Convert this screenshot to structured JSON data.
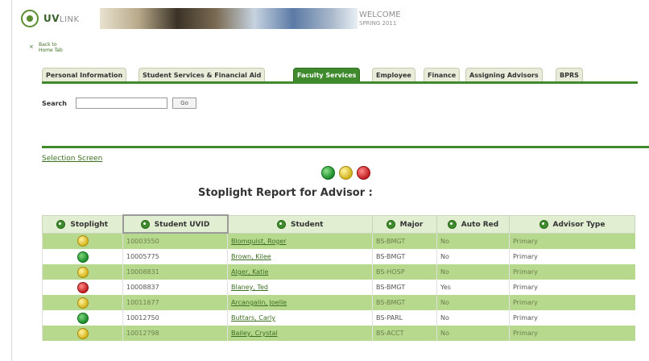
{
  "header": {
    "logo_text": "UV",
    "logo_sub": "LINK",
    "welcome": "WELCOME",
    "welcome_sub": "SPRING 2011"
  },
  "nav": {
    "back_line1": "Back to",
    "back_line2": "Home Tab",
    "back_icon": "×"
  },
  "tabs": [
    {
      "label": "Personal Information",
      "active": false
    },
    {
      "label": "Student Services & Financial Aid",
      "active": false
    },
    {
      "label": "Faculty Services",
      "active": true
    },
    {
      "label": "Employee",
      "active": false
    },
    {
      "label": "Finance",
      "active": false
    },
    {
      "label": "Assigning Advisors",
      "active": false
    },
    {
      "label": "BPRS",
      "active": false
    }
  ],
  "search": {
    "label": "Search",
    "value": "",
    "button": "Go"
  },
  "selection_link": "Selection Screen",
  "report_title": "Stoplight Report for Advisor :",
  "table": {
    "columns": [
      "Stoplight",
      "Student UVID",
      "Student",
      "Major",
      "Auto Red",
      "Advisor Type"
    ],
    "rows": [
      {
        "stoplight": "yellow",
        "uvid": "10003550",
        "student": "Blomquist, Roger",
        "major": "BS-BMGT",
        "auto_red": "No",
        "advisor_type": "Primary"
      },
      {
        "stoplight": "green",
        "uvid": "10005775",
        "student": "Brown, Kilee",
        "major": "BS-BMGT",
        "auto_red": "No",
        "advisor_type": "Primary"
      },
      {
        "stoplight": "yellow",
        "uvid": "10008831",
        "student": "Alger, Katie",
        "major": "BS-HOSP",
        "auto_red": "No",
        "advisor_type": "Primary"
      },
      {
        "stoplight": "red",
        "uvid": "10008837",
        "student": "Blaney, Ted",
        "major": "BS-BMGT",
        "auto_red": "Yes",
        "advisor_type": "Primary"
      },
      {
        "stoplight": "yellow",
        "uvid": "10011677",
        "student": "Arcangalin, Joelle",
        "major": "BS-BMGT",
        "auto_red": "No",
        "advisor_type": "Primary"
      },
      {
        "stoplight": "green",
        "uvid": "10012750",
        "student": "Buttars, Carly",
        "major": "BS-PARL",
        "auto_red": "No",
        "advisor_type": "Primary"
      },
      {
        "stoplight": "yellow",
        "uvid": "10012798",
        "student": "Bailey, Crystal",
        "major": "BS-ACCT",
        "auto_red": "No",
        "advisor_type": "Primary"
      }
    ]
  },
  "colors": {
    "accent": "#3f8a2c",
    "row_alt": "#b7d98d",
    "header_bg": "#e2eed2"
  }
}
